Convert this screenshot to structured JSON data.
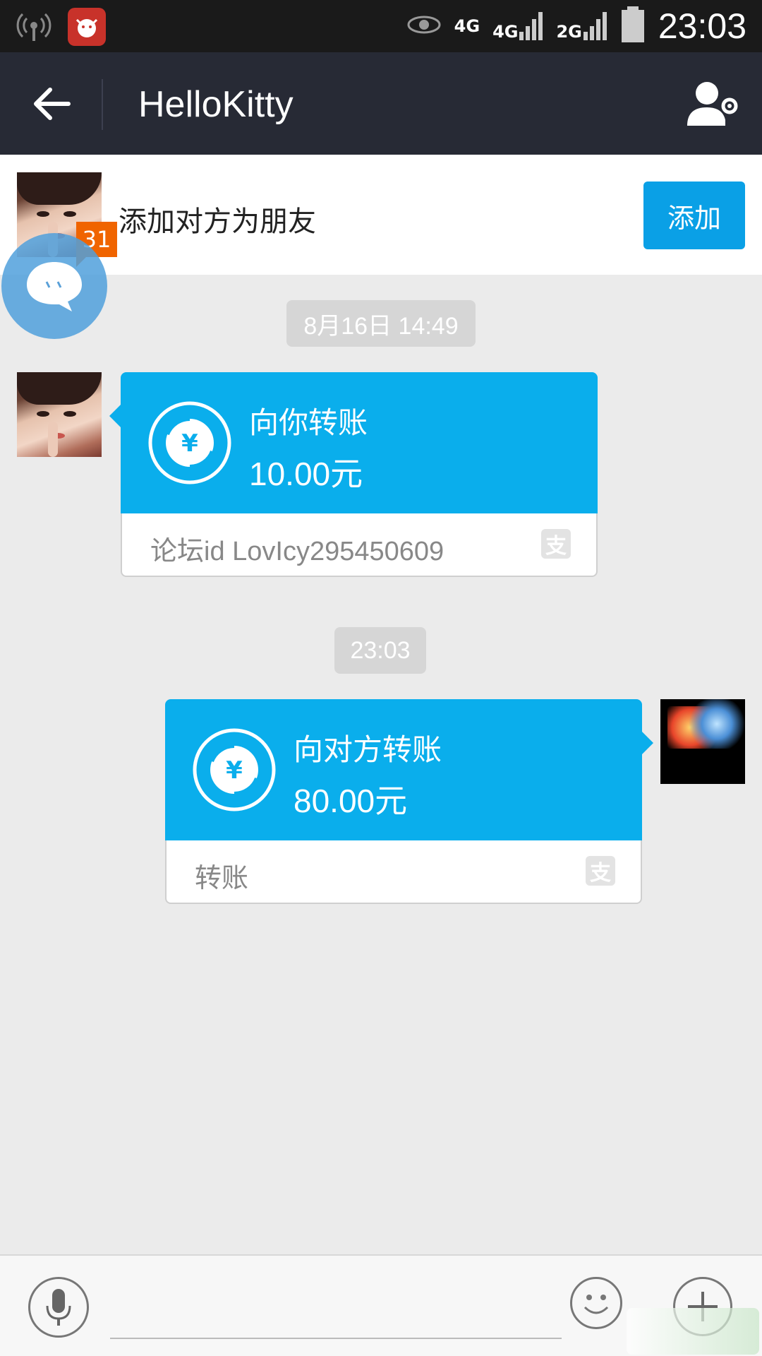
{
  "status_bar": {
    "network_1": "4G",
    "network_2": "4G",
    "network_3": "2G",
    "time": "23:03"
  },
  "header": {
    "title": "HelloKitty"
  },
  "add_friend_bar": {
    "text": "添加对方为朋友",
    "button_label": "添加",
    "badge_count": "31"
  },
  "messages": [
    {
      "timestamp": "8月16日 14:49",
      "direction": "incoming",
      "title": "向你转账",
      "amount": "10.00元",
      "note": "论坛id LovIcy295450609"
    },
    {
      "timestamp": "23:03",
      "direction": "outgoing",
      "title": "向对方转账",
      "amount": "80.00元",
      "note": "转账"
    }
  ],
  "colors": {
    "accent": "#0aaeec",
    "title_bar": "#272a35",
    "chat_bg": "#ebebeb"
  }
}
